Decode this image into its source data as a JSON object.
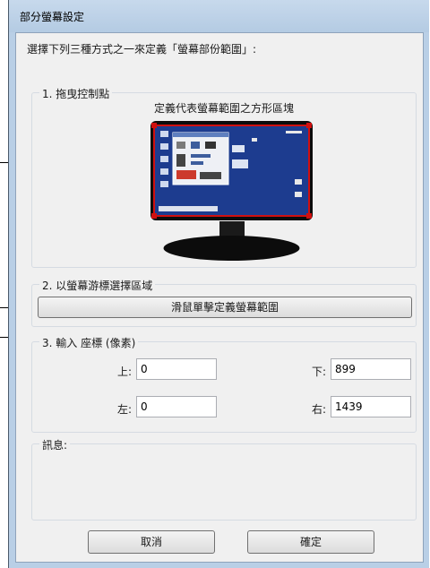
{
  "window": {
    "title": "部分螢幕設定"
  },
  "instruction": "選擇下列三種方式之一來定義「螢幕部份範圍」:",
  "section1": {
    "label": "1. 拖曳控制點",
    "subtitle": "定義代表螢幕範圍之方形區塊",
    "preview_icon": "monitor-with-selection-icon"
  },
  "section2": {
    "label": "2. 以螢幕游標選擇區域",
    "button_label": "滑鼠單擊定義螢幕範圍"
  },
  "section3": {
    "label": "3. 輸入 座標 (像素)",
    "top_label": "上:",
    "top_value": "0",
    "bottom_label": "下:",
    "bottom_value": "899",
    "left_label": "左:",
    "left_value": "0",
    "right_label": "右:",
    "right_value": "1439"
  },
  "message": {
    "label": "訊息:",
    "text": ""
  },
  "buttons": {
    "cancel": "取消",
    "ok": "確定"
  },
  "colors": {
    "frame": "#b9cfe6",
    "screen_blue": "#1d3c8f",
    "selection_red": "#d01010"
  }
}
